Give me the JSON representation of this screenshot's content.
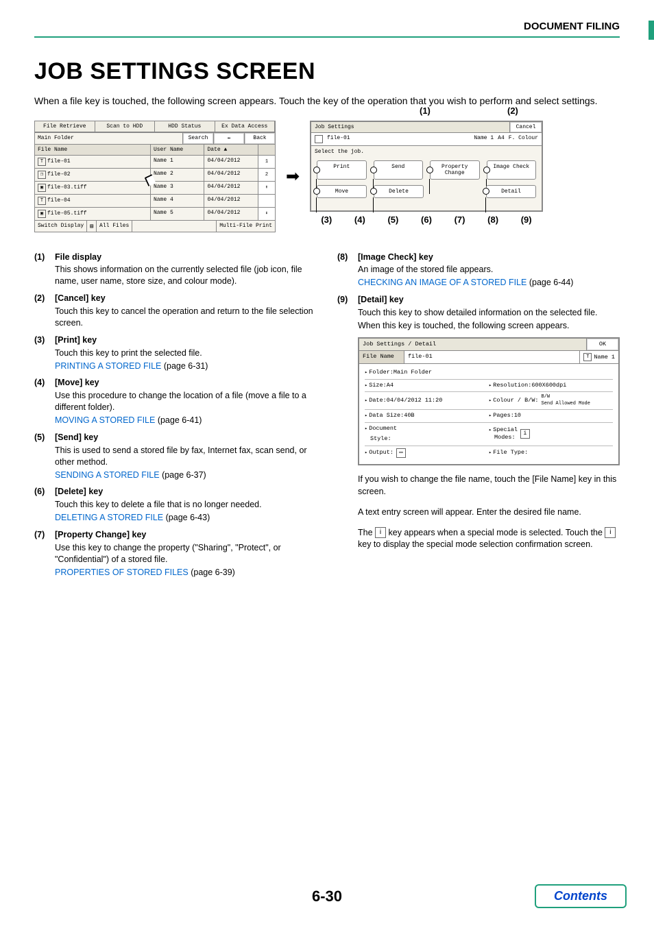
{
  "breadcrumb": "DOCUMENT FILING",
  "heading": "JOB SETTINGS SCREEN",
  "intro": "When a file key is touched, the following screen appears. Touch the key of the operation that you wish to perform and select settings.",
  "left_panel": {
    "tabs": [
      "File Retrieve",
      "Scan to HDD",
      "HDD Status",
      "Ex Data Access"
    ],
    "main_folder": "Main Folder",
    "search": "Search",
    "back_arrow": "⬅",
    "back": "Back",
    "col_hdrs": {
      "file": "File Name",
      "user": "User Name",
      "date": "Date",
      "sort_glyph": "▲"
    },
    "rows": [
      {
        "icon": "T",
        "file": "file-01",
        "user": "Name 1",
        "date": "04/04/2012"
      },
      {
        "icon": "❐",
        "file": "file-02",
        "user": "Name 2",
        "date": "04/04/2012"
      },
      {
        "icon": "▣",
        "file": "file-03.tiff",
        "user": "Name 3",
        "date": "04/04/2012"
      },
      {
        "icon": "T",
        "file": "file-04",
        "user": "Name 4",
        "date": "04/04/2012"
      },
      {
        "icon": "▣",
        "file": "file-05.tiff",
        "user": "Name 5",
        "date": "04/04/2012"
      }
    ],
    "side": {
      "top": "1",
      "bottom": "2",
      "up": "⬆",
      "down": "⬇"
    },
    "footer": {
      "switch": "Switch Display",
      "all": "All Files",
      "multi": "Multi-File Print"
    }
  },
  "arrow_glyph": "➡",
  "right_panel": {
    "callouts_top": {
      "c1": "(1)",
      "c2": "(2)"
    },
    "title": "Job Settings",
    "cancel": "Cancel",
    "info": {
      "file": "file-01",
      "user": "Name 1",
      "size": "A4",
      "mode": "F. Colour"
    },
    "select": "Select the job.",
    "btns_r1": [
      "Print",
      "Send",
      "Property Change",
      "Image Check"
    ],
    "btns_r2": [
      "Move",
      "Delete",
      "",
      "Detail"
    ],
    "callouts_bottom": [
      "(3)",
      "(4)",
      "(5)",
      "(6)",
      "(7)",
      "(8)",
      "(9)"
    ]
  },
  "explain_left": [
    {
      "num": "(1)",
      "title": "File display",
      "desc": "This shows information on the currently selected file (job icon, file name, user name, store size, and colour mode)."
    },
    {
      "num": "(2)",
      "title": "[Cancel] key",
      "desc": "Touch this key to cancel the operation and return to the file selection screen."
    },
    {
      "num": "(3)",
      "title": "[Print] key",
      "desc": "Touch this key to print the selected file.",
      "link": "PRINTING A STORED FILE",
      "link_after": " (page 6-31)"
    },
    {
      "num": "(4)",
      "title": "[Move] key",
      "desc": "Use this procedure to change the location of a file (move a file to a different folder).",
      "link": "MOVING A STORED FILE",
      "link_after": " (page 6-41)"
    },
    {
      "num": "(5)",
      "title": "[Send] key",
      "desc": "This is used to send a stored file by fax, Internet fax, scan send, or other method.",
      "link": "SENDING A STORED FILE",
      "link_after": " (page 6-37)"
    },
    {
      "num": "(6)",
      "title": "[Delete] key",
      "desc": "Touch this key to delete a file that is no longer needed.",
      "link": "DELETING A STORED FILE",
      "link_after": " (page 6-43)"
    },
    {
      "num": "(7)",
      "title": "[Property Change] key",
      "desc": "Use this key to change the property (\"Sharing\", \"Protect\", or \"Confidential\") of a stored file.",
      "link": "PROPERTIES OF STORED FILES",
      "link_after": " (page 6-39)"
    }
  ],
  "explain_right_top": [
    {
      "num": "(8)",
      "title": "[Image Check] key",
      "desc": "An image of the stored file appears.",
      "link": "CHECKING AN IMAGE OF A STORED FILE",
      "link_after": " (page 6-44)"
    },
    {
      "num": "(9)",
      "title": "[Detail] key",
      "desc": "Touch this key to show detailed information on the selected file.",
      "desc2": "When this key is touched, the following screen appears."
    }
  ],
  "detail_panel": {
    "title": "Job Settings / Detail",
    "ok": "OK",
    "file_name_label": "File Name",
    "file_name_value": "file-01",
    "user_label": "Name 1",
    "rows": [
      {
        "l": "Folder:Main Folder",
        "r": ""
      },
      {
        "l": "Size:A4",
        "r": "Resolution:600X600dpi"
      },
      {
        "l": "Date:04/04/2012 11:20",
        "r": "Colour / B/W:",
        "r2a": "B/W",
        "r2b": "Send Allowed Mode"
      },
      {
        "l": "Data Size:40B",
        "r": "Pages:10"
      },
      {
        "l": "Document",
        "l2": "Style:",
        "r": "Special",
        "r2": "Modes:",
        "icon": "i"
      },
      {
        "l": "Output:",
        "licon": "▭",
        "r": "File Type:"
      }
    ]
  },
  "post_detail": {
    "p1": "If you wish to change the file name, touch the [File Name] key in this screen.",
    "p2": "A text entry screen will appear. Enter the desired file name.",
    "p3a": "The ",
    "p3b": " key appears when a special mode is selected. Touch the ",
    "p3c": " key to display the special mode selection confirmation screen.",
    "info_glyph": "i"
  },
  "page_number": "6-30",
  "contents_label": "Contents"
}
